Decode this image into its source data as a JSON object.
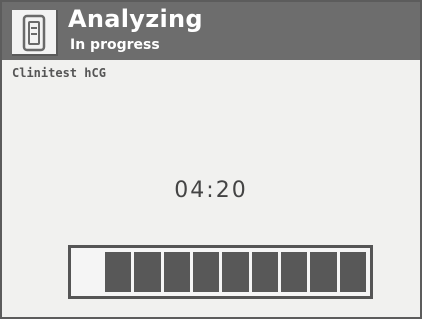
{
  "header": {
    "title": "Analyzing",
    "subtitle": "In progress",
    "icon": "test-cassette-icon"
  },
  "test": {
    "name": "Clinitest hCG"
  },
  "timer": {
    "value": "04:20"
  },
  "progress": {
    "filled_segments": 9,
    "total_segments": 10,
    "fraction": 0.9
  },
  "colors": {
    "header_bg": "#6d6d6d",
    "screen_bg": "#f1f1ef",
    "segment": "#585858"
  }
}
